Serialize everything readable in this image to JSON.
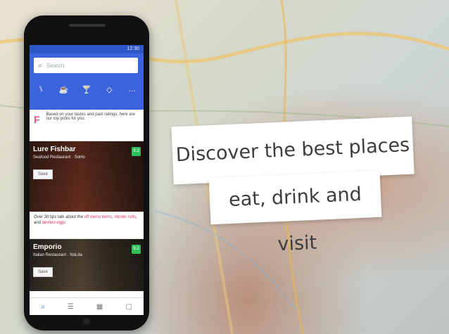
{
  "phone": {
    "status_time": "12:30",
    "search_placeholder": "Search",
    "categories": [
      "food-icon",
      "coffee-icon",
      "drink-icon",
      "shop-icon",
      "more-icon"
    ],
    "note_text": "Based on your tastes and past ratings, here are our top picks for you.",
    "venues": [
      {
        "name": "Lure Fishbar",
        "subtitle": "Seafood Restaurant · SoHo",
        "rating": "9.2",
        "save_label": "Save"
      },
      {
        "name": "Emporio",
        "subtitle": "Italian Restaurant · NoLita",
        "rating": "9.2",
        "save_label": "Save"
      }
    ],
    "tip": {
      "prefix": "Over 30 tips talk about the ",
      "highlight1": "off menu items",
      "middle": ", ",
      "highlight2": "lobster rolls",
      "middle2": ", and ",
      "highlight3": "deviled eggs"
    },
    "bottom_nav": [
      "search-tab-icon",
      "list-tab-icon",
      "activity-tab-icon",
      "profile-tab-icon"
    ]
  },
  "banner": {
    "line1": "Discover the best places to",
    "line2": "eat, drink and visit"
  }
}
